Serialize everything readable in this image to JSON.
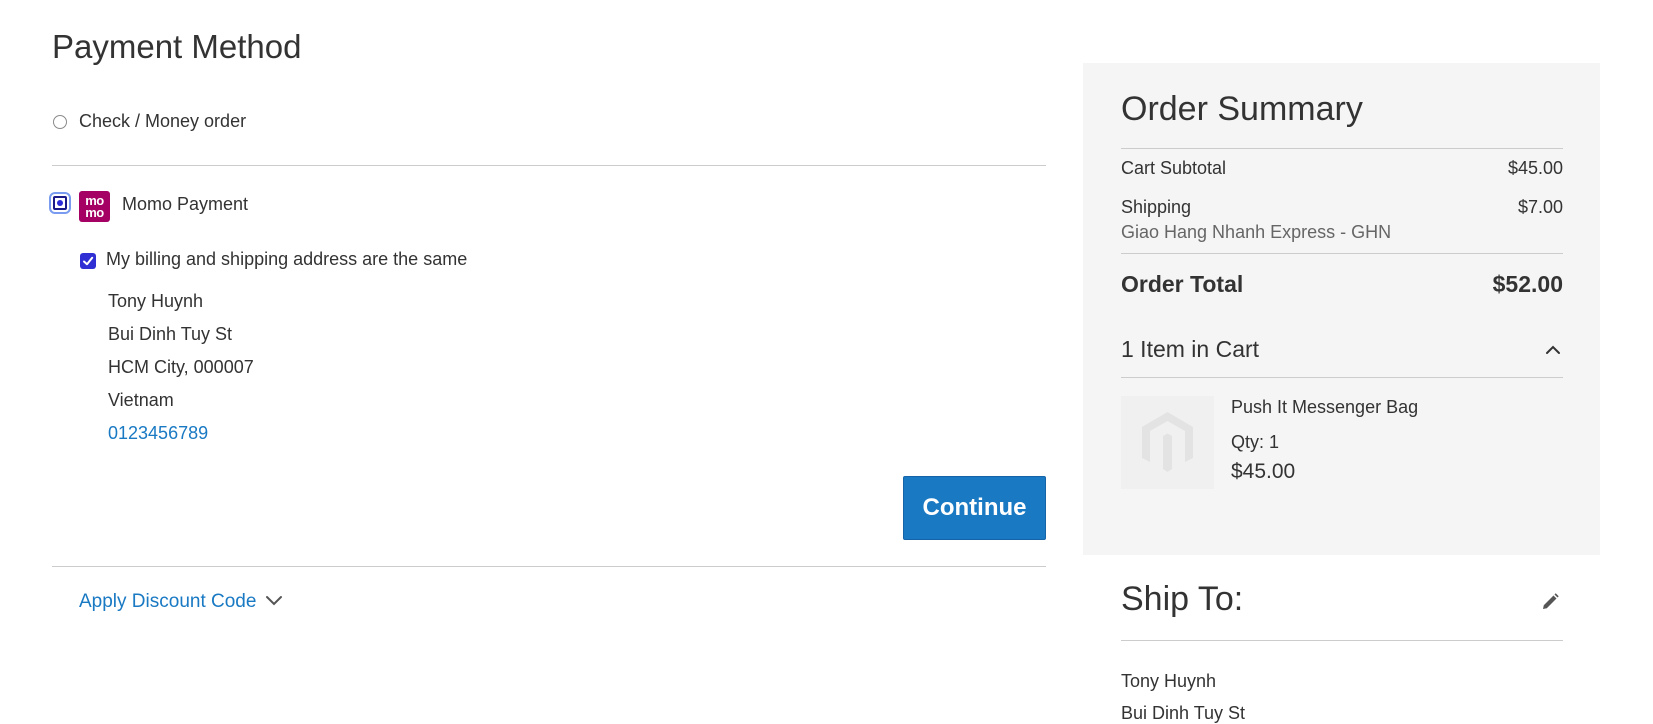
{
  "payment": {
    "title": "Payment Method",
    "option_check": "Check / Money order",
    "option_momo": "Momo Payment",
    "momo_logo_text": "mo mo",
    "billing_same_label": "My billing and shipping address are the same",
    "address": {
      "name": "Tony Huynh",
      "street": "Bui Dinh Tuy St",
      "city": "HCM City, 000007",
      "country": "Vietnam",
      "phone": "0123456789"
    },
    "continue_label": "Continue",
    "discount_label": "Apply Discount Code"
  },
  "summary": {
    "title": "Order Summary",
    "subtotal_label": "Cart Subtotal",
    "subtotal_value": "$45.00",
    "shipping_label": "Shipping",
    "shipping_value": "$7.00",
    "shipping_method": "Giao Hang Nhanh Express - GHN",
    "total_label": "Order Total",
    "total_value": "$52.00",
    "items_toggle": "1 Item in Cart",
    "item": {
      "name": "Push It Messenger Bag",
      "qty": "Qty: 1",
      "price": "$45.00"
    }
  },
  "shipto": {
    "title": "Ship To:",
    "name": "Tony Huynh",
    "street": "Bui Dinh Tuy St"
  },
  "colors": {
    "accent": "#1979c3",
    "momo_brand": "#a50064",
    "summary_bg": "#f5f5f5"
  },
  "icons": {
    "edit": "pencil-icon",
    "collapse": "chevron-up-icon",
    "expand": "chevron-down-icon",
    "placeholder": "magento-logo-icon"
  }
}
